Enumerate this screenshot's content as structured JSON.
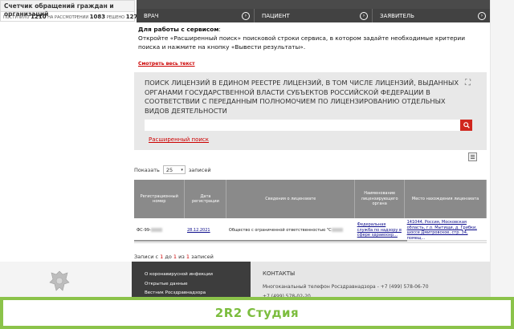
{
  "counter": {
    "title": "Счетчик обращений граждан и организаций",
    "received_label": "ПОСТУПИЛО",
    "received_value": "1210",
    "pending_label": "НА РАССМОТРЕНИИ",
    "pending_value": "1083",
    "resolved_label": "РЕШЕНО",
    "resolved_value": "127"
  },
  "topnav": {
    "items": [
      {
        "label": "ВРАЧ"
      },
      {
        "label": "ПАЦИЕНТ"
      },
      {
        "label": "ЗАЯВИТЕЛЬ"
      }
    ]
  },
  "info": {
    "heading": "Для работы с сервисом",
    "heading_suffix": ":",
    "text": "Откройте «Расширенный поиск» поисковой строки сервиса, в котором задайте необходимые критерии поиска и нажмите на кнопку «Вывести результаты».",
    "more_link": "Смотреть весь текст"
  },
  "search": {
    "title": "ПОИСК ЛИЦЕНЗИЙ В ЕДИНОМ РЕЕСТРЕ ЛИЦЕНЗИЙ, В ТОМ ЧИСЛЕ ЛИЦЕНЗИЙ, ВЫДАННЫХ ОРГАНАМИ ГОСУДАРСТВЕННОЙ ВЛАСТИ СУБЪЕКТОВ РОССИЙСКОЙ ФЕДЕРАЦИИ В СООТВЕТСТВИИ С ПЕРЕДАННЫМ ПОЛНОМОЧИЕМ ПО ЛИЦЕНЗИРОВАНИЮ ОТДЕЛЬНЫХ ВИДОВ ДЕЯТЕЛЬНОСТИ",
    "input_value": "",
    "advanced_link": "Расширенный поиск"
  },
  "list": {
    "show_label": "Показать",
    "page_size": "25",
    "records_label": "записей"
  },
  "table": {
    "headers": [
      "Регистрационный номер",
      "Дата регистрации",
      "Сведения о лицензиате",
      "Наименование лицензирующего органа",
      "Место нахождения лицензиата"
    ],
    "rows": [
      {
        "reg_number": "ФС-99-",
        "date": "28.12.2021",
        "licensee": "Общество с ограниченной ответственностью \"С",
        "authority": "Федеральная служба по надзору в сфере здравоохр...",
        "address": "141044, Россия, Московская область, г.о. Мытищи, д. Грибки, шоссе Дмитровское, стр. 34, помещ..."
      }
    ]
  },
  "records_info": {
    "prefix": "Записи с",
    "from": "1",
    "to_label": "до",
    "to": "1",
    "of_label": "из",
    "total": "1",
    "suffix": "записей"
  },
  "footer": {
    "links": [
      "О коронавирусной инфекции",
      "Открытые данные",
      "Вестник Росздравнадзора"
    ],
    "contacts_title": "КОНТАКТЫ",
    "phone_text": "Многоканальный телефон Росздравнадзора - +7 (499) 578-06-70",
    "phone2_text": "+7 (499) 578-02-20"
  },
  "banner": {
    "text": "2R2 Студия"
  },
  "colors": {
    "accent_red": "#d0261e",
    "nav_dark": "#424242",
    "banner_green": "#8bc34a"
  }
}
